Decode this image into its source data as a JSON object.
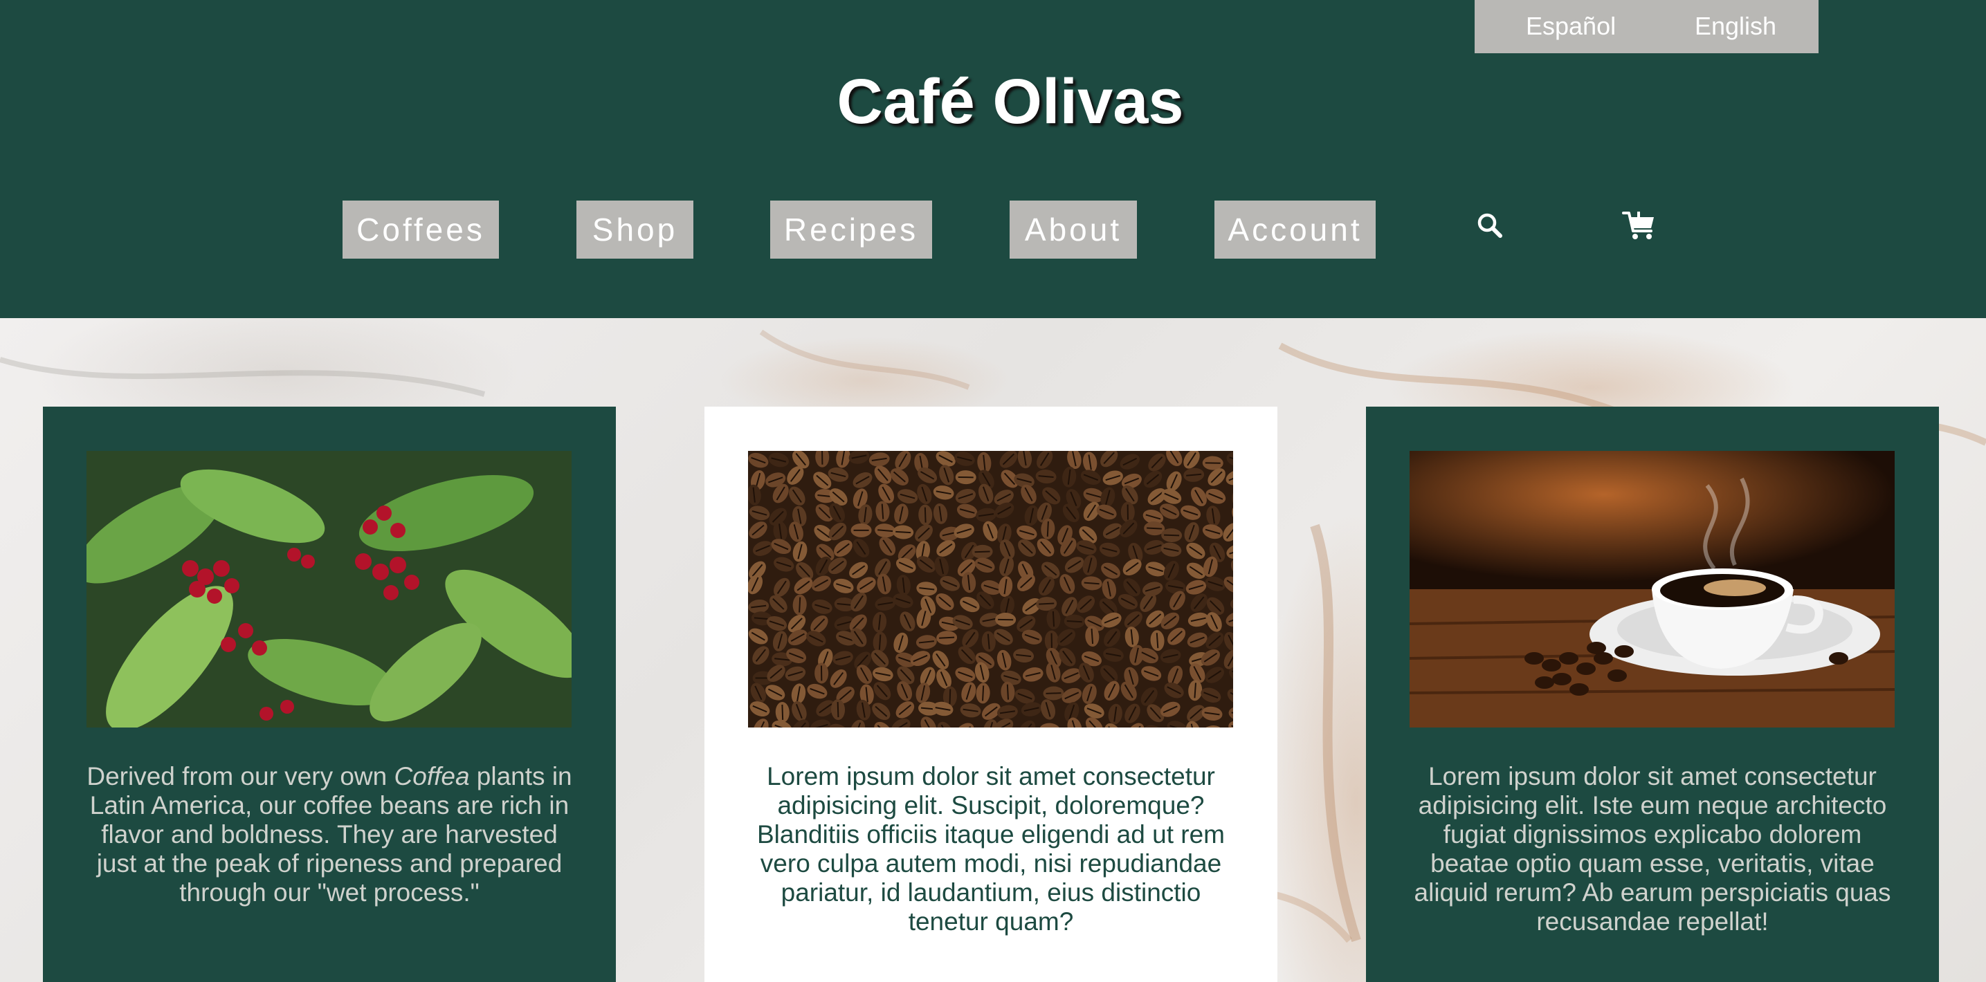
{
  "language_switcher": {
    "spanish": "Español",
    "english": "English"
  },
  "site_title": "Café Olivas",
  "nav": {
    "coffees": "Coffees",
    "shop": "Shop",
    "recipes": "Recipes",
    "about": "About",
    "account": "Account"
  },
  "icons": {
    "search": "search-icon",
    "cart": "cart-icon"
  },
  "colors": {
    "brand_green": "#1d4a41",
    "button_gray": "#b9b8b5",
    "white": "#ffffff"
  },
  "cards": [
    {
      "image": "coffee-plant-with-red-cherries",
      "text_before": "Derived from our very own ",
      "text_emphasis": "Coffea",
      "text_after": " plants in Latin America, our coffee beans are rich in flavor and boldness. They are harvested just at the peak of ripeness and prepared through our \"wet process.\""
    },
    {
      "image": "roasted-coffee-beans",
      "text": "Lorem ipsum dolor sit amet consectetur adipisicing elit. Suscipit, doloremque? Blanditiis officiis itaque eligendi ad ut rem vero culpa autem modi, nisi repudiandae pariatur, id laudantium, eius distinctio tenetur quam?"
    },
    {
      "image": "steaming-coffee-cup-on-saucer",
      "text": "Lorem ipsum dolor sit amet consectetur adipisicing elit. Iste eum neque architecto fugiat dignissimos explicabo dolorem beatae optio quam esse, veritatis, vitae aliquid rerum? Ab earum perspiciatis quas recusandae repellat!"
    }
  ]
}
